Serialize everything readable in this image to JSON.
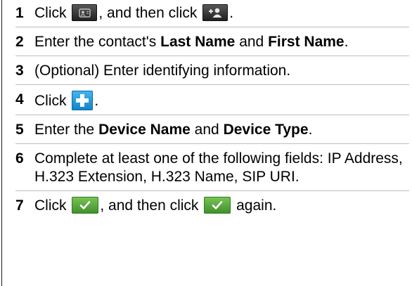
{
  "steps": [
    {
      "number": "1",
      "parts": [
        "Click",
        ", and then click",
        "."
      ],
      "icons": [
        "contacts-icon",
        "add-contact-icon"
      ]
    },
    {
      "number": "2",
      "parts": [
        "Enter the contact's",
        "Last Name",
        "and",
        "First Name",
        "."
      ]
    },
    {
      "number": "3",
      "text": "(Optional) Enter identifying information."
    },
    {
      "number": "4",
      "parts": [
        "Click",
        "."
      ],
      "icons": [
        "add-plus-icon"
      ]
    },
    {
      "number": "5",
      "parts": [
        "Enter the",
        "Device Name",
        "and",
        "Device Type",
        "."
      ]
    },
    {
      "number": "6",
      "text": "Complete at least one of the following fields: IP Address, H.323 Extension, H.323 Name, SIP URI."
    },
    {
      "number": "7",
      "parts": [
        "Click",
        ", and then click",
        "again."
      ],
      "icons": [
        "save-checkmark-icon",
        "save-checkmark-icon"
      ]
    }
  ],
  "colors": {
    "dark_button": "#2d2d2d",
    "blue_button": "#1a96dd",
    "green_button": "#5aa83f",
    "divider": "#bdbdbd"
  }
}
